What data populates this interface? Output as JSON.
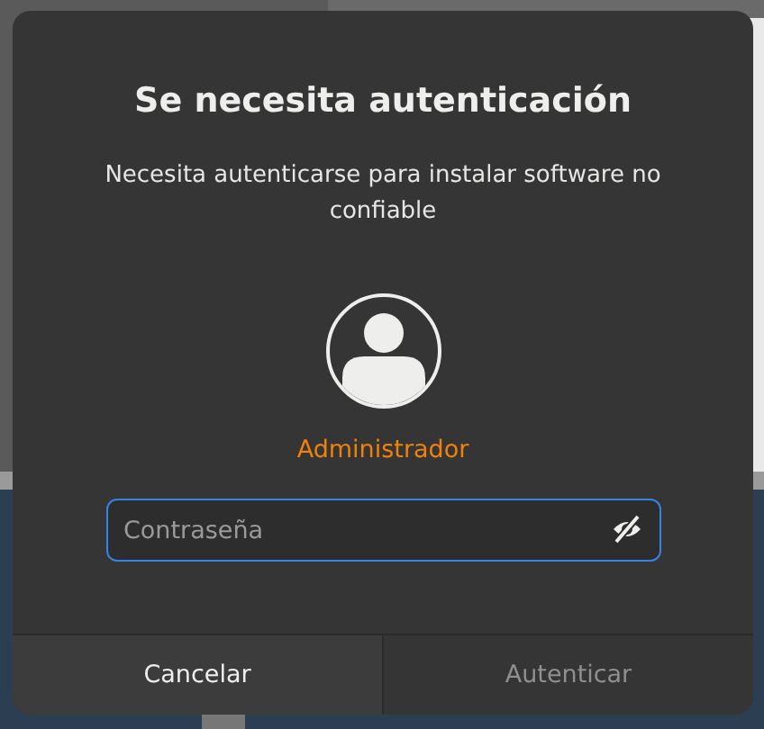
{
  "dialog": {
    "title": "Se necesita autenticación",
    "message": "Necesita autenticarse para instalar software no confiable",
    "user": {
      "name": "Administrador"
    },
    "password_field": {
      "placeholder": "Contraseña",
      "revealed": false
    },
    "buttons": [
      {
        "label": "Cancelar",
        "disabled": false
      },
      {
        "label": "Autenticar",
        "disabled": true
      }
    ]
  }
}
